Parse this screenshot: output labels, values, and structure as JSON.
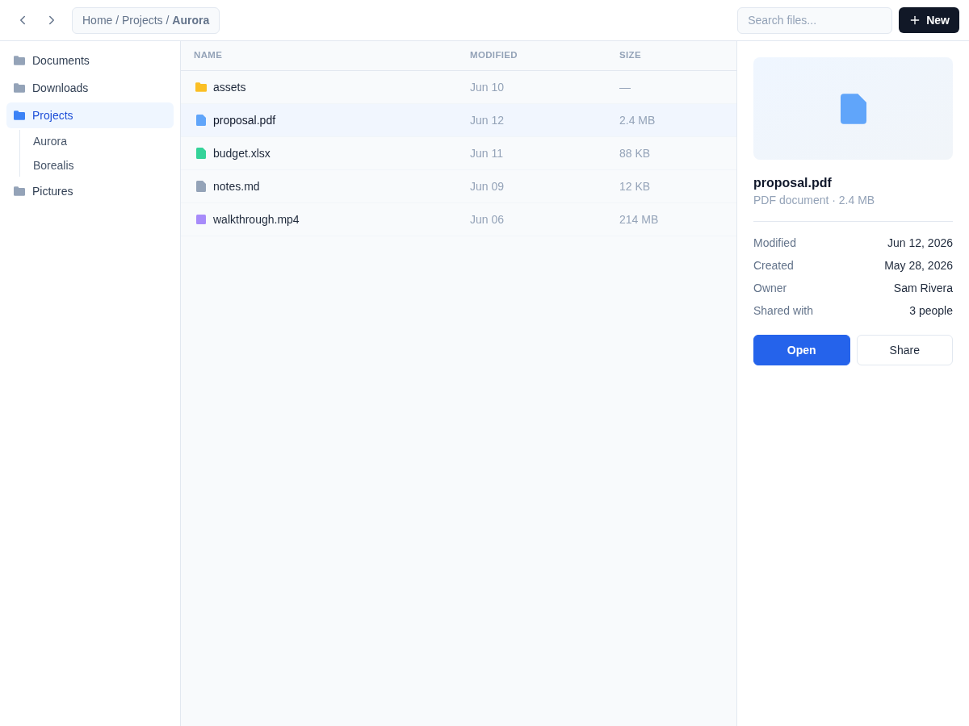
{
  "toolbar": {
    "breadcrumb": "Home / Projects / **Aurora**",
    "search": {
      "placeholder": "Search files..."
    },
    "new_button": "New"
  },
  "sidebar": {
    "items": [
      {
        "label": "Documents",
        "selected": false
      },
      {
        "label": "Downloads",
        "selected": false
      },
      {
        "label": "Projects",
        "selected": true,
        "children": [
          {
            "label": "Aurora"
          },
          {
            "label": "Borealis"
          }
        ]
      },
      {
        "label": "Pictures",
        "selected": false
      }
    ]
  },
  "table": {
    "columns": [
      "NAME",
      "MODIFIED",
      "SIZE"
    ],
    "rows": [
      {
        "name": "assets",
        "kind": "folder",
        "color": "#fbbf24",
        "modified": "Jun 10",
        "size": "—",
        "selected": false
      },
      {
        "name": "proposal.pdf",
        "kind": "file",
        "color": "#60a5fa",
        "modified": "Jun 12",
        "size": "2.4 MB",
        "selected": true
      },
      {
        "name": "budget.xlsx",
        "kind": "file",
        "color": "#34d399",
        "modified": "Jun 11",
        "size": "88 KB",
        "selected": false
      },
      {
        "name": "notes.md",
        "kind": "file",
        "color": "#94a3b8",
        "modified": "Jun 09",
        "size": "12 KB",
        "selected": false
      },
      {
        "name": "walkthrough.mp4",
        "kind": "media",
        "color": "#a78bfa",
        "modified": "Jun 06",
        "size": "214 MB",
        "selected": false
      }
    ]
  },
  "details": {
    "title": "proposal.pdf",
    "subtitle": "PDF document · 2.4 MB",
    "fields": [
      {
        "label": "Modified",
        "value": "Jun 12, 2026"
      },
      {
        "label": "Created",
        "value": "May 28, 2026"
      },
      {
        "label": "Owner",
        "value": "Sam Rivera"
      },
      {
        "label": "Shared with",
        "value": "3 people"
      }
    ],
    "buttons": [
      {
        "label": "Open",
        "kind": "primary"
      },
      {
        "label": "Share",
        "kind": "secondary"
      }
    ]
  }
}
